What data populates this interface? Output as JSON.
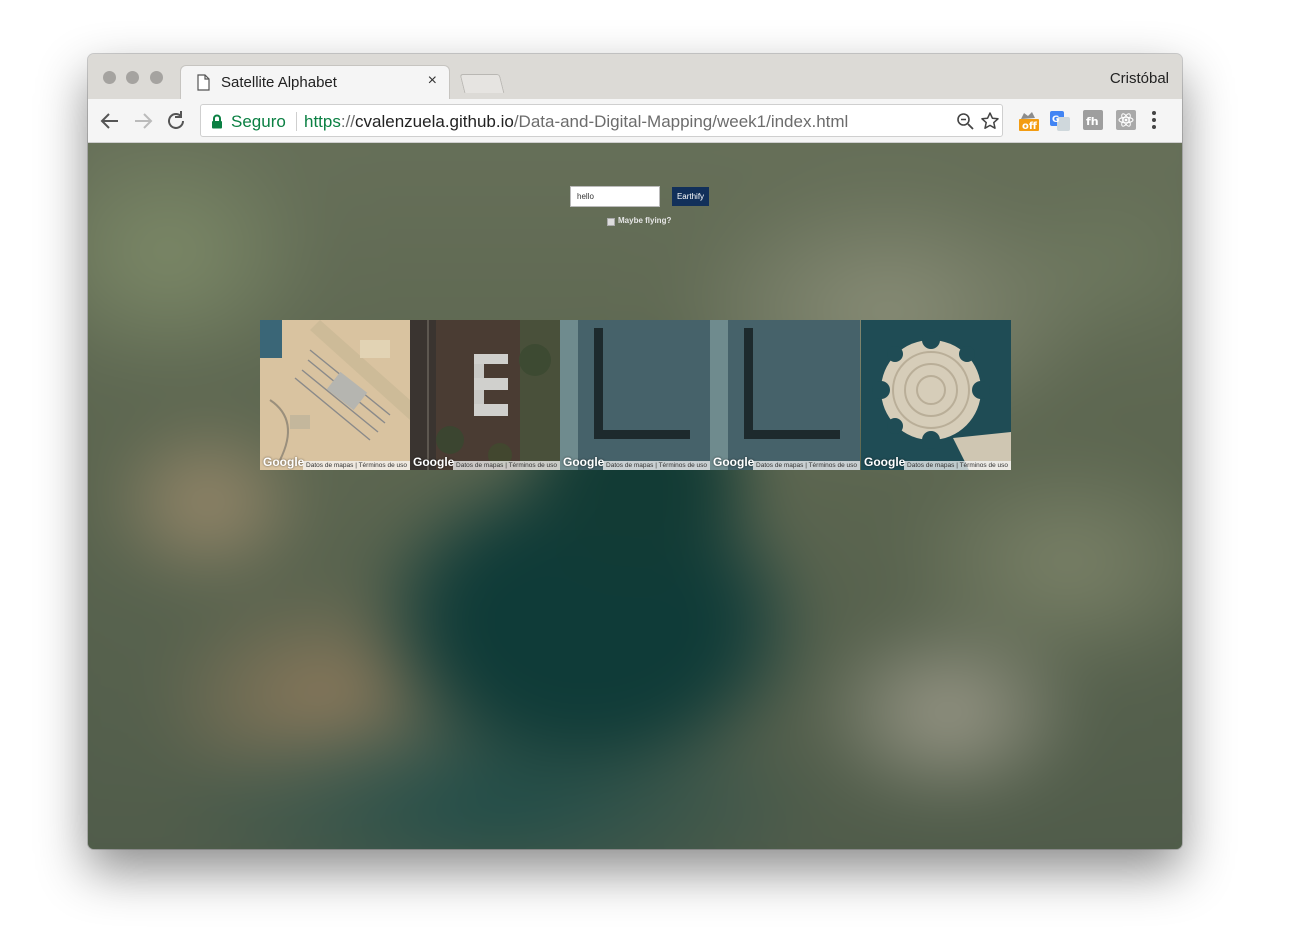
{
  "browser": {
    "tab_title": "Satellite Alphabet",
    "profile_name": "Cristóbal",
    "security_label": "Seguro",
    "url": {
      "scheme": "https",
      "separator": "://",
      "host": "cvalenzuela.github.io",
      "path": "/Data-and-Digital-Mapping/week1/index.html"
    },
    "extensions": [
      {
        "icon": "off-badge-icon",
        "label": "off"
      },
      {
        "icon": "google-translate-icon"
      },
      {
        "icon": "fh-extension-icon",
        "label": "fh"
      },
      {
        "icon": "react-devtools-icon"
      }
    ]
  },
  "page": {
    "input_value": "hello",
    "button_label": "Earthify",
    "checkbox_label": "Maybe flying?",
    "checkbox_checked": false,
    "tiles": [
      {
        "letter": "h",
        "google_label": "Google",
        "attrib_data": "Datos de mapas",
        "attrib_terms": "Términos de uso"
      },
      {
        "letter": "e",
        "google_label": "Google",
        "attrib_data": "Datos de mapas",
        "attrib_terms": "Términos de uso"
      },
      {
        "letter": "l",
        "google_label": "Google",
        "attrib_data": "Datos de mapas",
        "attrib_terms": "Términos de uso"
      },
      {
        "letter": "l",
        "google_label": "Google",
        "attrib_data": "Datos de mapas",
        "attrib_terms": "Términos de uso"
      },
      {
        "letter": "o",
        "google_label": "Google",
        "attrib_data": "Datos de mapas",
        "attrib_terms": "Términos de uso"
      }
    ]
  },
  "colors": {
    "secure_green": "#0b8043",
    "button_navy": "#12305a",
    "water_teal": "#3c5f66"
  }
}
